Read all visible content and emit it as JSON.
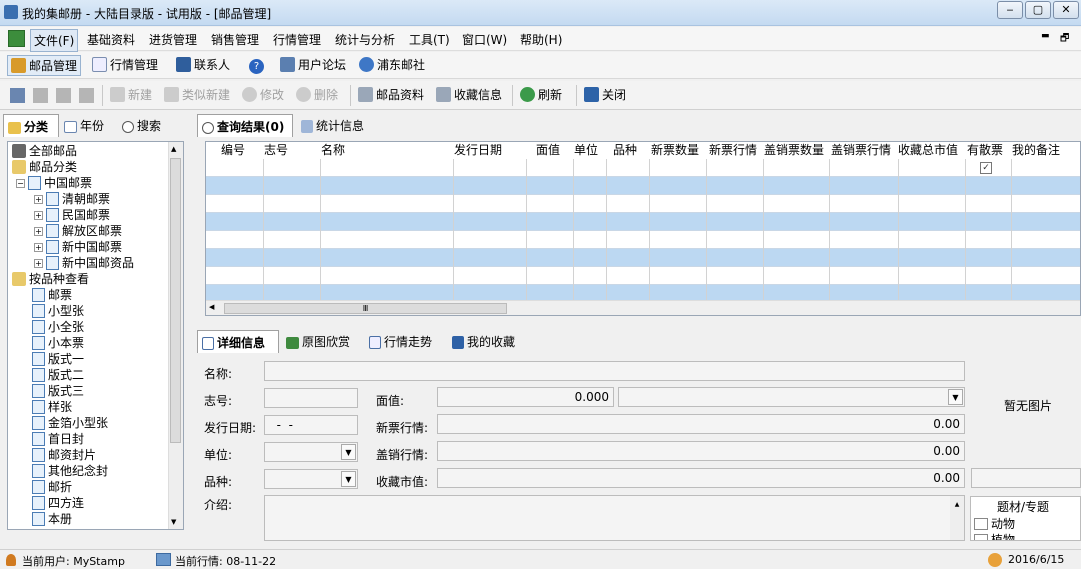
{
  "window": {
    "title": "我的集邮册 - 大陆目录版 - 试用版 - [邮品管理]"
  },
  "menu": {
    "items": [
      "文件(F)",
      "基础资料",
      "进货管理",
      "销售管理",
      "行情管理",
      "统计与分析",
      "工具(T)",
      "窗口(W)",
      "帮助(H)"
    ],
    "mdi_controls": [
      "▬",
      "🗗"
    ]
  },
  "nav": {
    "items": [
      "邮品管理",
      "行情管理",
      "联系人",
      "?",
      "用户论坛",
      "浦东邮社"
    ]
  },
  "toolbar": {
    "new": "新建",
    "similar_new": "类似新建",
    "edit": "修改",
    "delete": "删除",
    "stamp_info": "邮品资料",
    "collection_info": "收藏信息",
    "refresh": "刷新",
    "close": "关闭"
  },
  "left_tabs": [
    "分类",
    "年份",
    "搜索"
  ],
  "tree": {
    "root": "全部邮品",
    "category_root": "邮品分类",
    "china": "中国邮票",
    "china_children": [
      "清朝邮票",
      "民国邮票",
      "解放区邮票",
      "新中国邮票",
      "新中国邮资品"
    ],
    "by_type": "按品种查看",
    "types": [
      "邮票",
      "小型张",
      "小全张",
      "小本票",
      "版式一",
      "版式二",
      "版式三",
      "样张",
      "金箔小型张",
      "首日封",
      "邮资封片",
      "其他纪念封",
      "邮折",
      "四方连",
      "本册"
    ]
  },
  "result_tabs": [
    "查询结果(0)",
    "统计信息"
  ],
  "grid": {
    "columns": [
      "编号",
      "志号",
      "名称",
      "发行日期",
      "面值",
      "单位",
      "品种",
      "新票数量",
      "新票行情",
      "盖销票数量",
      "盖销票行情",
      "收藏总市值",
      "有散票",
      "我的备注"
    ],
    "scroll_thumb": "Ⅲ"
  },
  "detail_tabs": [
    "详细信息",
    "原图欣赏",
    "行情走势",
    "我的收藏"
  ],
  "detail": {
    "name_label": "名称:",
    "code_label": "志号:",
    "face_label": "面值:",
    "face_value": "0.000",
    "date_label": "发行日期:",
    "date_value": "  -  -",
    "new_price_label": "新票行情:",
    "new_price_value": "0.00",
    "unit_label": "单位:",
    "used_price_label": "盖销行情:",
    "used_price_value": "0.00",
    "variety_label": "品种:",
    "market_label": "收藏市值:",
    "market_value": "0.00",
    "intro_label": "介绍:",
    "no_image": "暂无图片",
    "theme_header": "题材/专题",
    "themes": [
      "动物",
      "植物"
    ]
  },
  "status": {
    "user": "当前用户: MyStamp",
    "market": "当前行情: 08-11-22",
    "date": "2016/6/15"
  },
  "colors": {
    "grid_stripe": "#bcd8f2",
    "title_bar": "#c4daf1"
  }
}
